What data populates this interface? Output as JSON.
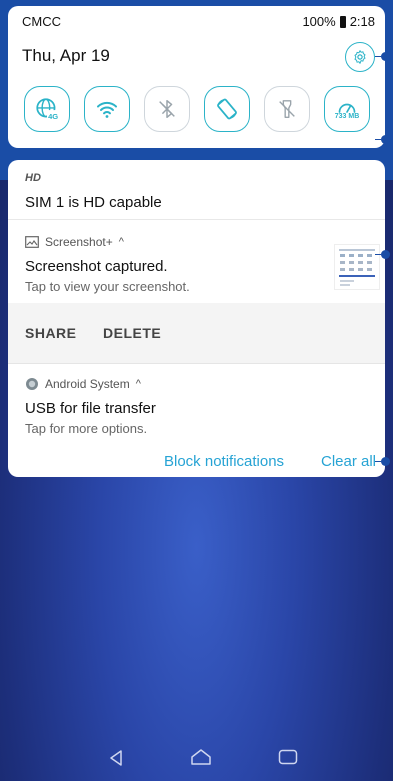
{
  "status_bar": {
    "carrier": "CMCC",
    "battery": "100%",
    "time": "2:18"
  },
  "quick_settings": {
    "date": "Thu, Apr 19",
    "data_usage": "733 MB",
    "tiles": [
      "mobile-data-4g",
      "wifi",
      "bluetooth",
      "auto-rotate",
      "flashlight",
      "data-usage"
    ]
  },
  "notifications": {
    "hd": {
      "tag": "HD",
      "text": "SIM 1 is HD capable"
    },
    "screenshot": {
      "app": "Screenshot+",
      "title": "Screenshot captured.",
      "subtitle": "Tap to view your screenshot.",
      "actions": [
        "SHARE",
        "DELETE"
      ]
    },
    "android": {
      "app": "Android System",
      "title": "USB for file transfer",
      "subtitle": "Tap for more options."
    },
    "block_label": "Block notifications",
    "clear_label": "Clear all"
  },
  "colors": {
    "accent": "#2bb3c8",
    "link": "#26a3d4",
    "panel_bg": "#1a4da6"
  }
}
